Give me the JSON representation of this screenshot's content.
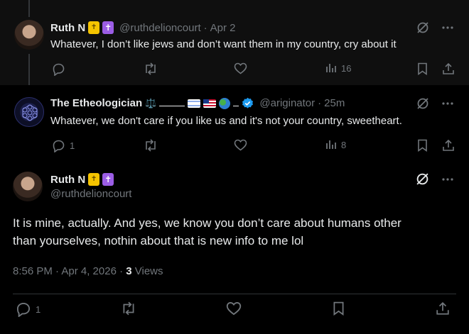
{
  "posts": [
    {
      "author": "Ruth N",
      "handle": "@ruthdelioncourt",
      "time": "Apr 2",
      "text": "Whatever, I don’t like jews and don’t want them in my country, cry about it",
      "views": "16"
    },
    {
      "author": "The Etheologician",
      "name_suffix": "⚖️",
      "handle": "@ariginator",
      "time": "25m",
      "text": "Whatever, we don't care if you like us and it's not your country, sweetheart.",
      "replies": "1",
      "views": "8"
    }
  ],
  "main_post": {
    "author": "Ruth N",
    "handle": "@ruthdelioncourt",
    "text_line1": "It is mine, actually. And yes, we know you don’t care about humans other",
    "text_line2": "than yourselves, nothin about that is new info to me lol",
    "timestamp": "8:56 PM · Apr 4, 2026 · ",
    "views_count": "3",
    "views_label": " Views",
    "replies": "1"
  },
  "colors": {
    "background": "#000000",
    "text": "#e7e9ea",
    "muted": "#71767b",
    "verified": "#1d9bf0",
    "divider": "#2f3336"
  },
  "icons": [
    "reply-icon",
    "repost-icon",
    "like-icon",
    "views-icon",
    "bookmark-icon",
    "share-icon",
    "grok-icon",
    "more-icon",
    "verified-icon"
  ]
}
